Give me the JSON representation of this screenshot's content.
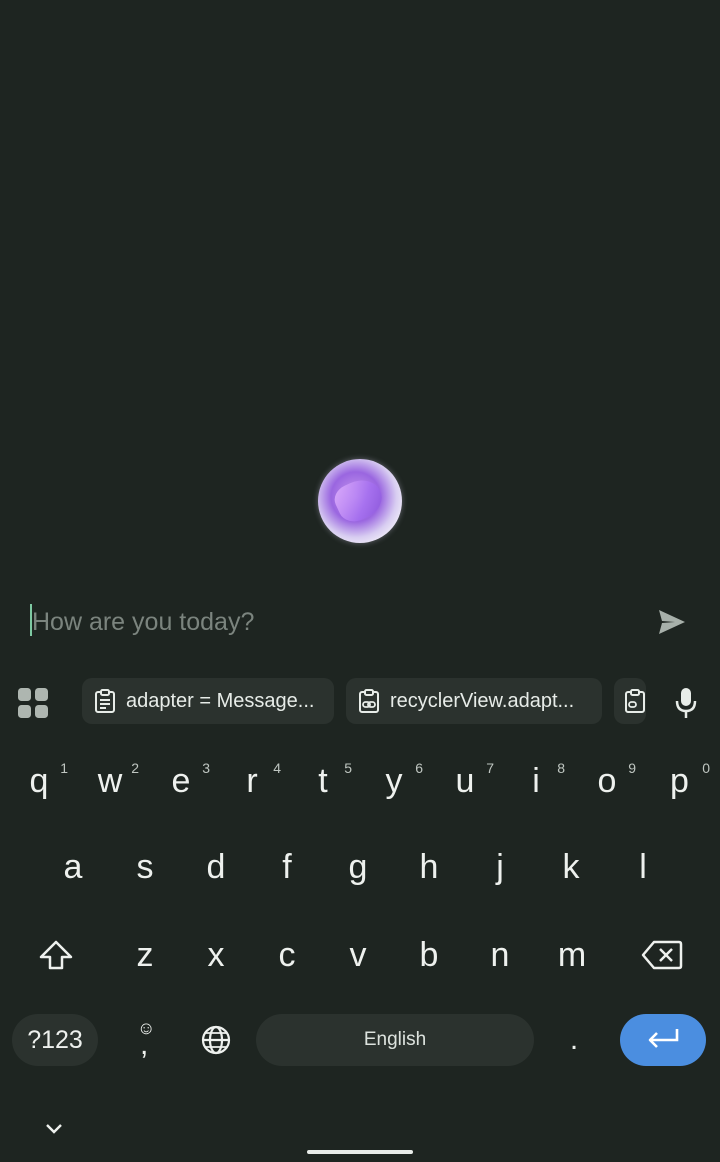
{
  "chat": {
    "input_placeholder": "How are you today?"
  },
  "keyboard_toolbar": {
    "clip_items": [
      {
        "label": "adapter = Message..."
      },
      {
        "label": "recyclerView.adapt..."
      }
    ]
  },
  "keyboard": {
    "row1": [
      {
        "key": "q",
        "hint": "1"
      },
      {
        "key": "w",
        "hint": "2"
      },
      {
        "key": "e",
        "hint": "3"
      },
      {
        "key": "r",
        "hint": "4"
      },
      {
        "key": "t",
        "hint": "5"
      },
      {
        "key": "y",
        "hint": "6"
      },
      {
        "key": "u",
        "hint": "7"
      },
      {
        "key": "i",
        "hint": "8"
      },
      {
        "key": "o",
        "hint": "9"
      },
      {
        "key": "p",
        "hint": "0"
      }
    ],
    "row2": [
      "a",
      "s",
      "d",
      "f",
      "g",
      "h",
      "j",
      "k",
      "l"
    ],
    "row3": [
      "z",
      "x",
      "c",
      "v",
      "b",
      "n",
      "m"
    ],
    "symbols_label": "?123",
    "comma_label": ",",
    "space_label": "English",
    "period_label": "."
  },
  "colors": {
    "background": "#1e2521",
    "chip": "#2b322e",
    "enter_accent": "#4b8ee0",
    "cursor": "#7ec9a2"
  }
}
